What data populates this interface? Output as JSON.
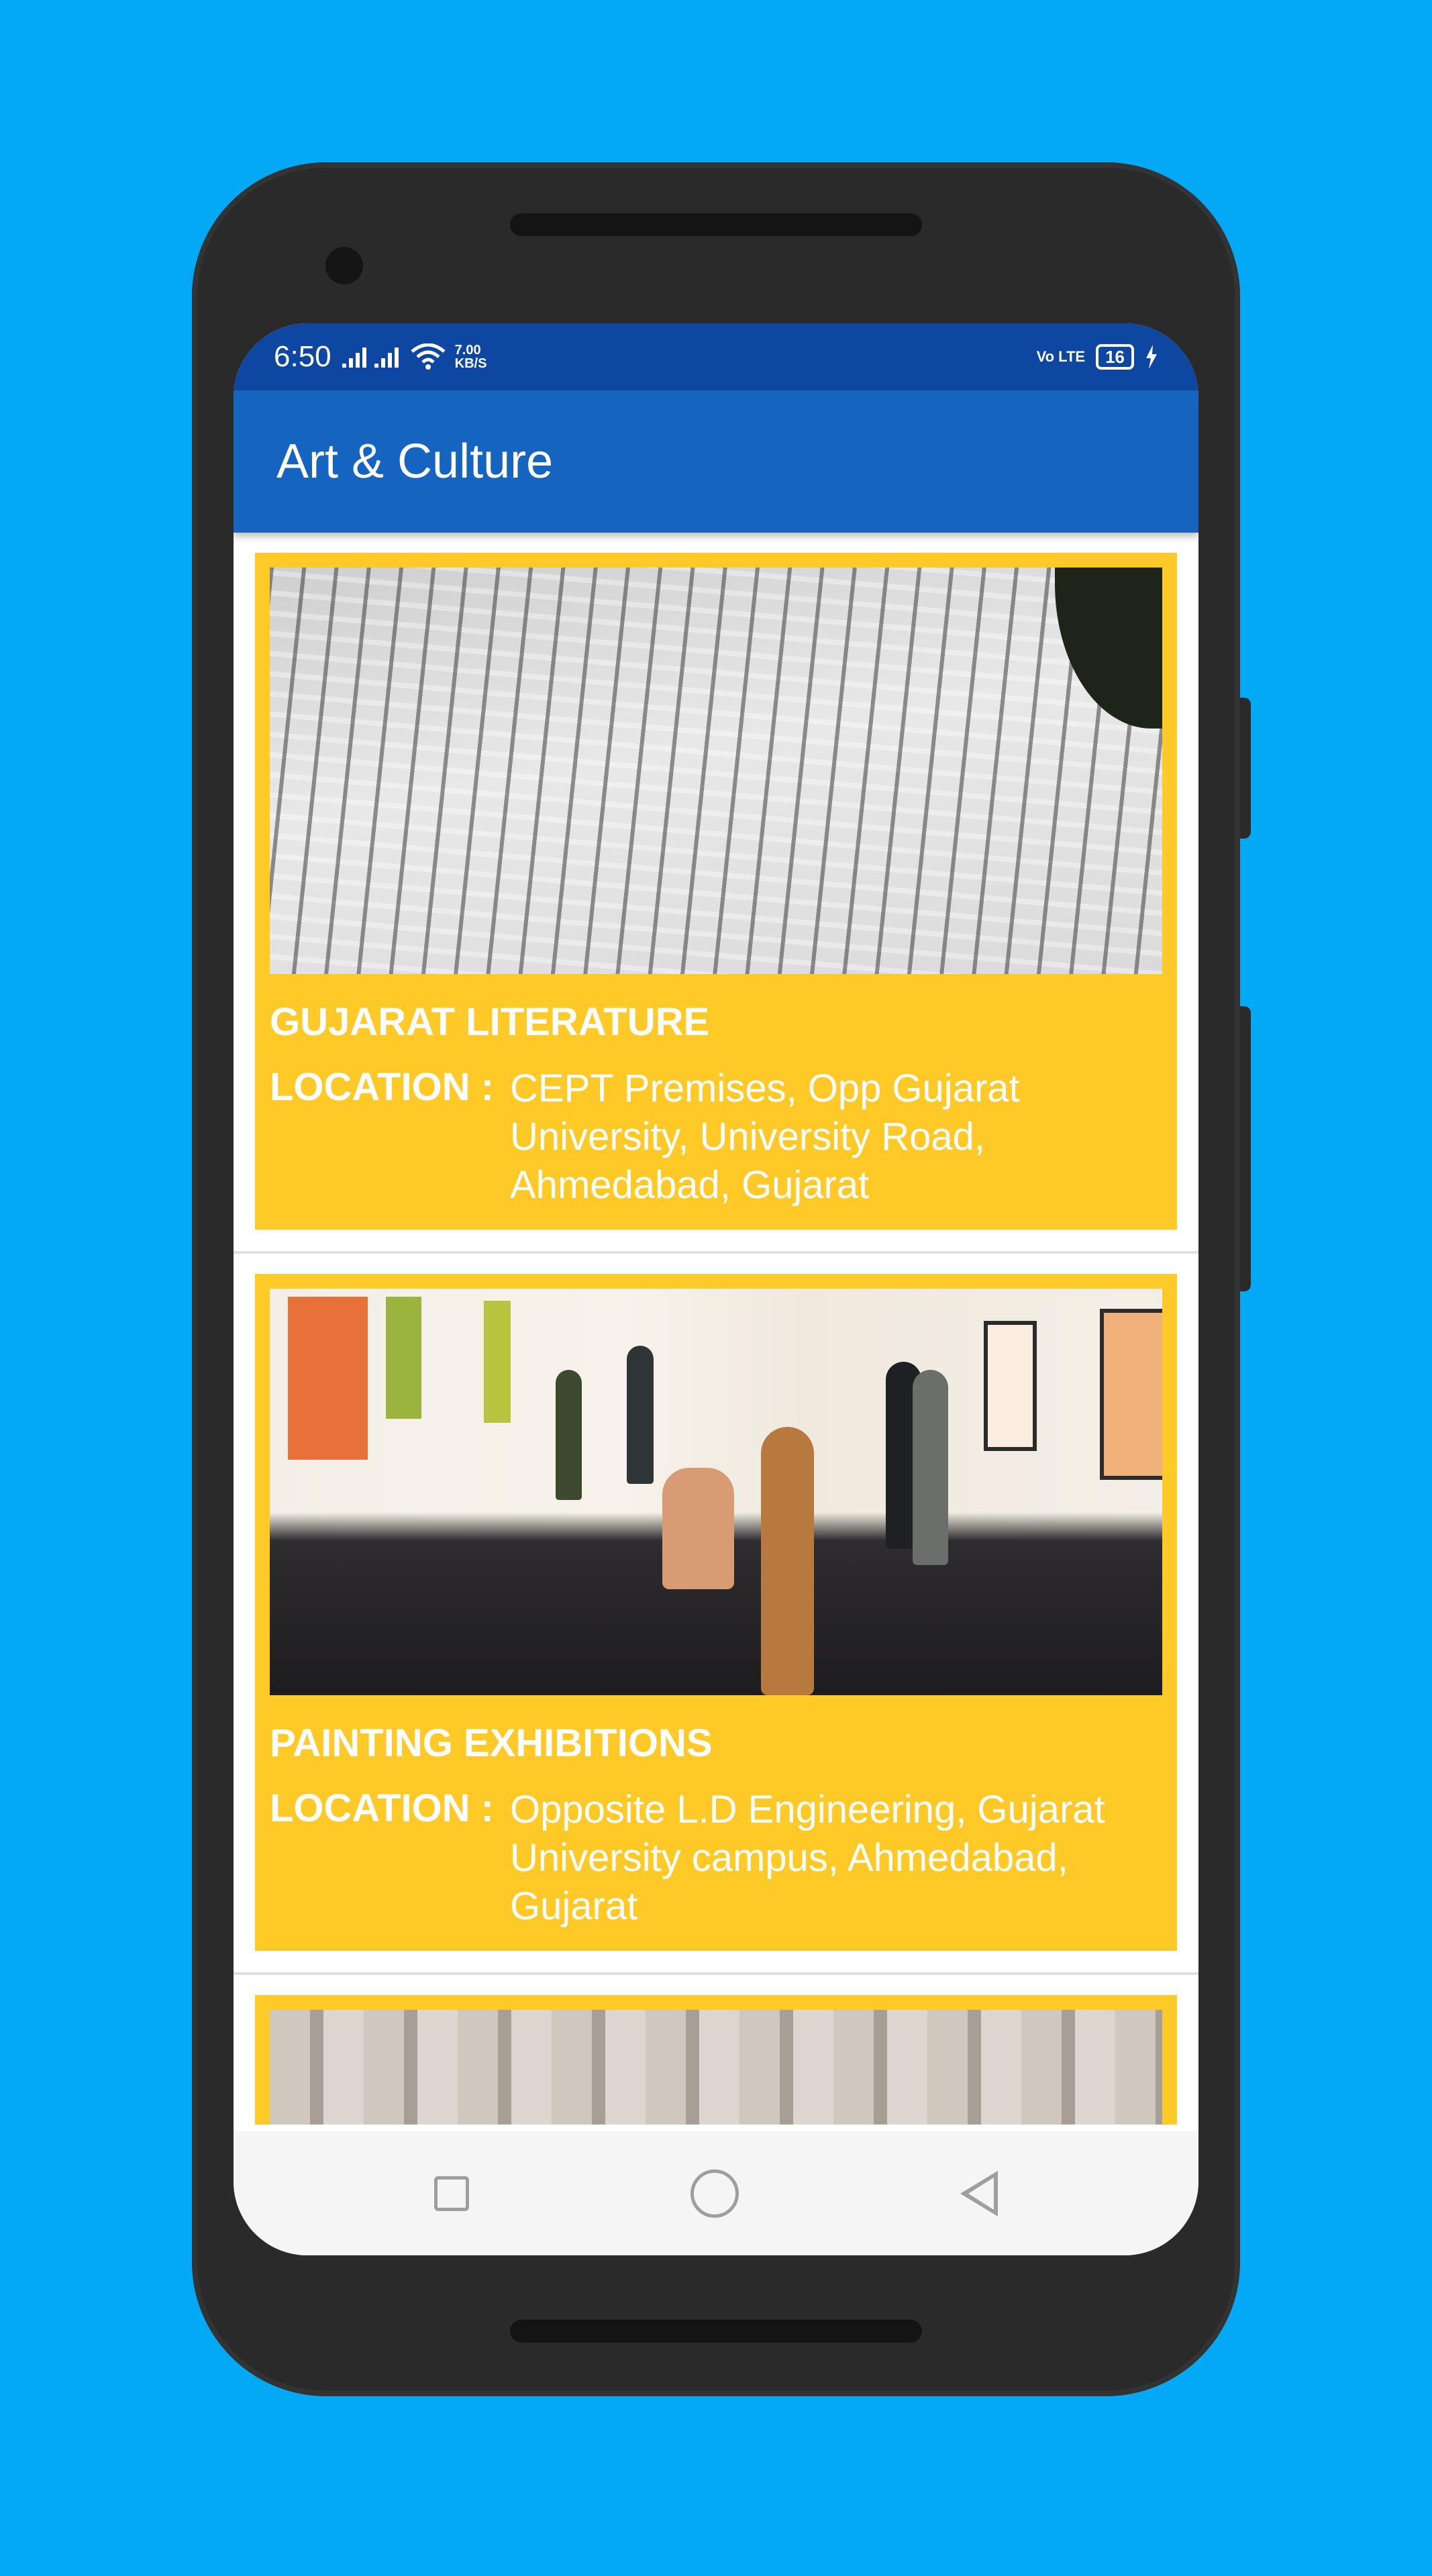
{
  "status_bar": {
    "time": "6:50",
    "speed_value": "7.00",
    "speed_unit": "KB/S",
    "volte": "Vo LTE",
    "battery": "16"
  },
  "app_bar": {
    "title": "Art & Culture"
  },
  "cards": [
    {
      "title": "GUJARAT LITERATURE",
      "location_label": "LOCATION :",
      "location": "CEPT Premises, Opp Gujarat University, University Road, Ahmedabad, Gujarat"
    },
    {
      "title": "PAINTING EXHIBITIONS",
      "location_label": "LOCATION :",
      "location": "Opposite L.D Engineering, Gujarat University campus, Ahmedabad, Gujarat"
    }
  ],
  "colors": {
    "background": "#03A9F4",
    "status_bar": "#0D47A1",
    "app_bar": "#1565C0",
    "card": "#FFCA28"
  },
  "icons": {
    "nav_recent": "square-icon",
    "nav_home": "circle-icon",
    "nav_back": "triangle-back-icon"
  }
}
